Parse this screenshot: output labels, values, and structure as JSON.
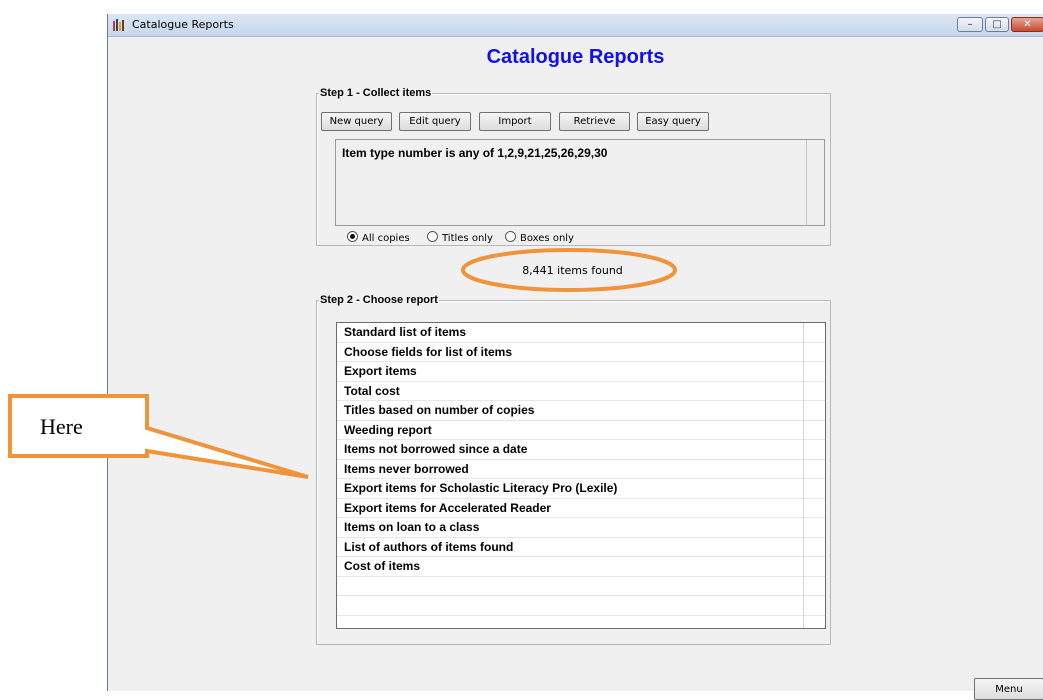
{
  "window": {
    "title": "Catalogue Reports",
    "controls": {
      "minimize": "–",
      "maximize": "□",
      "close": "✕"
    }
  },
  "main_title": "Catalogue Reports",
  "step1": {
    "legend": "Step 1 - Collect items",
    "buttons": [
      "New query",
      "Edit query",
      "Import",
      "Retrieve",
      "Easy query"
    ],
    "query_text": "Item type number is any of 1,2,9,21,25,26,29,30",
    "options": [
      {
        "label": "All copies",
        "selected": true
      },
      {
        "label": "Titles only",
        "selected": false
      },
      {
        "label": "Boxes only",
        "selected": false
      }
    ]
  },
  "found_text": "8,441 items found",
  "step2": {
    "legend": "Step 2 - Choose report",
    "reports": [
      "Standard list of items",
      "Choose fields for list of items",
      "Export items",
      "Total cost",
      "Titles based on number of copies",
      "Weeding report",
      "Items not borrowed since a date",
      "Items never borrowed",
      "Export items for Scholastic Literacy Pro (Lexile)",
      "Export items for Accelerated Reader",
      "Items on loan to a class",
      "List of authors of items found",
      "Cost of items",
      "",
      "",
      ""
    ]
  },
  "menu_button": "Menu",
  "annotation": {
    "label": "Here",
    "color": "#f0943c"
  }
}
